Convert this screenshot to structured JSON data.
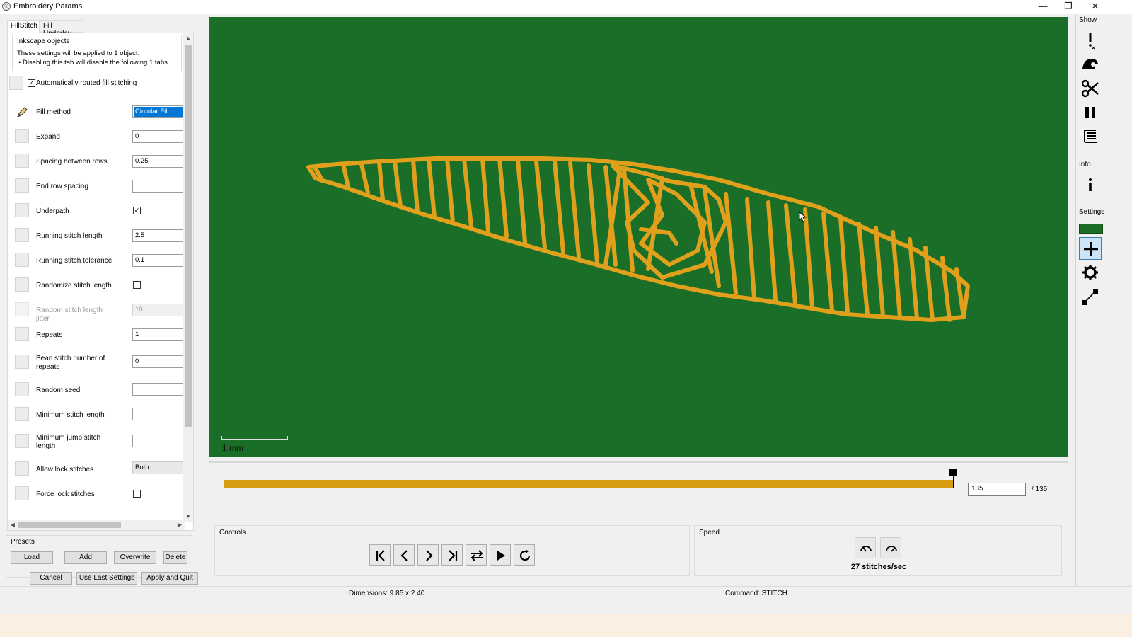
{
  "window": {
    "title": "Embroidery Params",
    "minimize_icon": "minimize-icon",
    "restore_icon": "restore-icon",
    "close_icon": "close-icon"
  },
  "tabs": [
    "FillStitch",
    "Fill Underlay"
  ],
  "info": {
    "caption": "Inkscape objects",
    "line1": "These settings will be applied to 1 object.",
    "line2": "• Disabling this tab will disable the following 1 tabs."
  },
  "auto_route": {
    "label": "Automatically routed fill stitching",
    "checked": true
  },
  "params": [
    {
      "label": "Fill method",
      "value": "Circular Fill",
      "icon": "pencil-icon"
    },
    {
      "label": "Expand",
      "value": "0"
    },
    {
      "label": "Spacing between rows",
      "value": "0.25"
    },
    {
      "label": "End row spacing",
      "value": ""
    },
    {
      "label": "Underpath",
      "checkbox": true,
      "checked": true
    },
    {
      "label": "Running stitch length",
      "value": "2.5"
    },
    {
      "label": "Running stitch tolerance",
      "value": "0.1"
    },
    {
      "label": "Randomize stitch length",
      "checkbox": true,
      "checked": false
    },
    {
      "label": "Random stitch length jitter",
      "value": "10",
      "disabled": true
    },
    {
      "label": "Repeats",
      "value": "1"
    },
    {
      "label": "Bean stitch number of repeats",
      "value": "0"
    },
    {
      "label": "Random seed",
      "value": ""
    },
    {
      "label": "Minimum stitch length",
      "value": ""
    },
    {
      "label": "Minimum jump stitch length",
      "value": ""
    },
    {
      "label": "Allow lock stitches",
      "value": "Both"
    },
    {
      "label": "Force lock stitches",
      "checkbox": true,
      "checked": false
    }
  ],
  "presets": {
    "caption": "Presets",
    "load": "Load",
    "add": "Add",
    "overwrite": "Overwrite",
    "delete": "Delete"
  },
  "dialog_buttons": {
    "cancel": "Cancel",
    "use_last": "Use Last Settings",
    "apply": "Apply and Quit"
  },
  "canvas": {
    "background": "#1a6e28",
    "thread_color": "#e0a01c",
    "scale_label": "1 mm"
  },
  "slider": {
    "current": "135",
    "max": "/ 135",
    "progress": 1.0
  },
  "controls": {
    "caption": "Controls",
    "buttons": [
      "first-stitch-icon",
      "previous-icon",
      "next-icon",
      "last-stitch-icon",
      "direction-toggle-icon",
      "play-icon",
      "restart-icon"
    ]
  },
  "speed": {
    "caption": "Speed",
    "value": "27 stitches/sec",
    "buttons": [
      "slower-icon",
      "faster-icon"
    ]
  },
  "sidebar": {
    "show_label": "Show",
    "info_label": "Info",
    "settings_label": "Settings",
    "show_buttons": [
      "jump-warning-icon",
      "trim-icon",
      "scissors-icon",
      "stop-icon",
      "color-change-icon"
    ],
    "info_button": "info-icon",
    "settings_buttons": [
      "crosshair-icon",
      "gear-icon",
      "needle-point-icon"
    ]
  },
  "status": {
    "dimensions": "Dimensions: 9.85 x 2.40",
    "command": "Command: STITCH"
  }
}
